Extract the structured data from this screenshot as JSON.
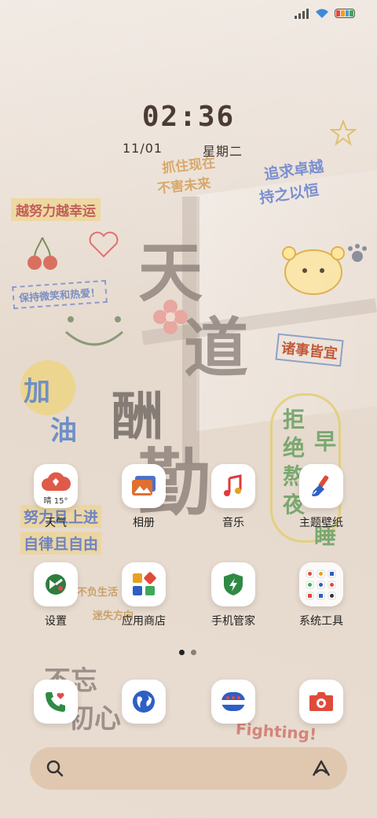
{
  "status_bar": {
    "signal_icon": "signal-bars-icon",
    "wifi_icon": "wifi-icon",
    "battery_icon": "battery-icon"
  },
  "lockscreen_widget": {
    "time": "02:36",
    "date": "11/01",
    "weekday": "星期二"
  },
  "wallpaper": {
    "texts": {
      "t1": "抓住现在",
      "t2": "不害未来",
      "t3": "追求卓越",
      "t4": "持之以恒",
      "t5": "越努力越幸运",
      "t6": "保持微笑和热爱！",
      "t7": "天",
      "t8": "道",
      "t9": "酬",
      "t10": "勤",
      "t11": "加",
      "t12": "油",
      "t13": "诸事皆宜",
      "t14": "拒",
      "t15": "绝",
      "t16": "熬",
      "t17": "夜",
      "t18": "早",
      "t19": "睡",
      "t20": "努力且上进",
      "t21": "自律且自由",
      "t22": "不负生活",
      "t23": "迷失方向",
      "t24": "不忘",
      "t25": "初心",
      "t26": "Fighting!"
    }
  },
  "apps_row1": [
    {
      "label": "天气",
      "icon": "weather-cloud-icon",
      "badge": "晴 15°"
    },
    {
      "label": "相册",
      "icon": "gallery-icon"
    },
    {
      "label": "音乐",
      "icon": "music-note-icon"
    },
    {
      "label": "主题壁纸",
      "icon": "theme-brush-icon"
    }
  ],
  "apps_row2": [
    {
      "label": "设置",
      "icon": "settings-icon"
    },
    {
      "label": "应用商店",
      "icon": "app-store-icon"
    },
    {
      "label": "手机管家",
      "icon": "security-shield-icon"
    },
    {
      "label": "系统工具",
      "icon": "system-tools-folder-icon"
    }
  ],
  "page_indicator": {
    "pages": 2,
    "current": 1
  },
  "dock": [
    {
      "name": "phone",
      "icon": "phone-icon"
    },
    {
      "name": "browser",
      "icon": "browser-globe-icon"
    },
    {
      "name": "messages",
      "icon": "messages-icon"
    },
    {
      "name": "camera",
      "icon": "camera-icon"
    }
  ],
  "search_bar": {
    "search_icon": "search-icon",
    "assistant_icon": "assistant-icon"
  },
  "colors": {
    "battery_seg1": "#e04a3a",
    "battery_seg2": "#f0a020",
    "battery_seg3": "#4a9ad8",
    "battery_seg4": "#3fa858",
    "dot_active": "#222222",
    "dot_inactive": "#8a7f78"
  }
}
